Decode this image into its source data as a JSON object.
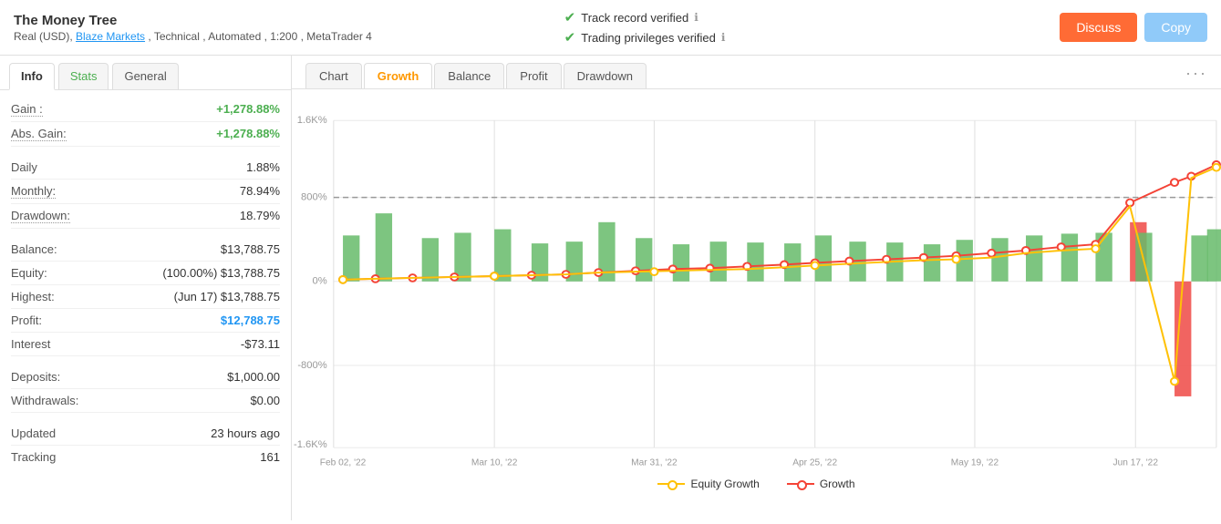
{
  "header": {
    "title": "The Money Tree",
    "subtitle": "Real (USD), Blaze Markets , Technical , Automated , 1:200 , MetaTrader 4",
    "blaze_link": "Blaze Markets",
    "verified1": "Track record verified",
    "verified2": "Trading privileges verified",
    "btn_discuss": "Discuss",
    "btn_copy": "Copy"
  },
  "left_tabs": [
    {
      "label": "Info",
      "active": true
    },
    {
      "label": "Stats",
      "active": false
    },
    {
      "label": "General",
      "active": false
    }
  ],
  "stats": {
    "gain_label": "Gain :",
    "gain_value": "+1,278.88%",
    "abs_gain_label": "Abs. Gain:",
    "abs_gain_value": "+1,278.88%",
    "daily_label": "Daily",
    "daily_value": "1.88%",
    "monthly_label": "Monthly:",
    "monthly_value": "78.94%",
    "drawdown_label": "Drawdown:",
    "drawdown_value": "18.79%",
    "balance_label": "Balance:",
    "balance_value": "$13,788.75",
    "equity_label": "Equity:",
    "equity_value": "(100.00%) $13,788.75",
    "highest_label": "Highest:",
    "highest_value": "(Jun 17) $13,788.75",
    "profit_label": "Profit:",
    "profit_value": "$12,788.75",
    "interest_label": "Interest",
    "interest_value": "-$73.11",
    "deposits_label": "Deposits:",
    "deposits_value": "$1,000.00",
    "withdrawals_label": "Withdrawals:",
    "withdrawals_value": "$0.00",
    "updated_label": "Updated",
    "updated_value": "23 hours ago",
    "tracking_label": "Tracking",
    "tracking_value": "161"
  },
  "chart_tabs": [
    {
      "label": "Chart",
      "active": false
    },
    {
      "label": "Growth",
      "active": true
    },
    {
      "label": "Balance",
      "active": false
    },
    {
      "label": "Profit",
      "active": false
    },
    {
      "label": "Drawdown",
      "active": false
    }
  ],
  "chart": {
    "y_labels": [
      "1.6K%",
      "800%",
      "0%",
      "-800%",
      "-1.6K%"
    ],
    "x_labels": [
      "Feb 02, '22",
      "Mar 10, '22",
      "Mar 31, '22",
      "Apr 25, '22",
      "May 19, '22",
      "Jun 17, '22"
    ],
    "dashed_line_pct": 0.8
  },
  "legend": {
    "equity_growth": "Equity Growth",
    "growth": "Growth"
  }
}
